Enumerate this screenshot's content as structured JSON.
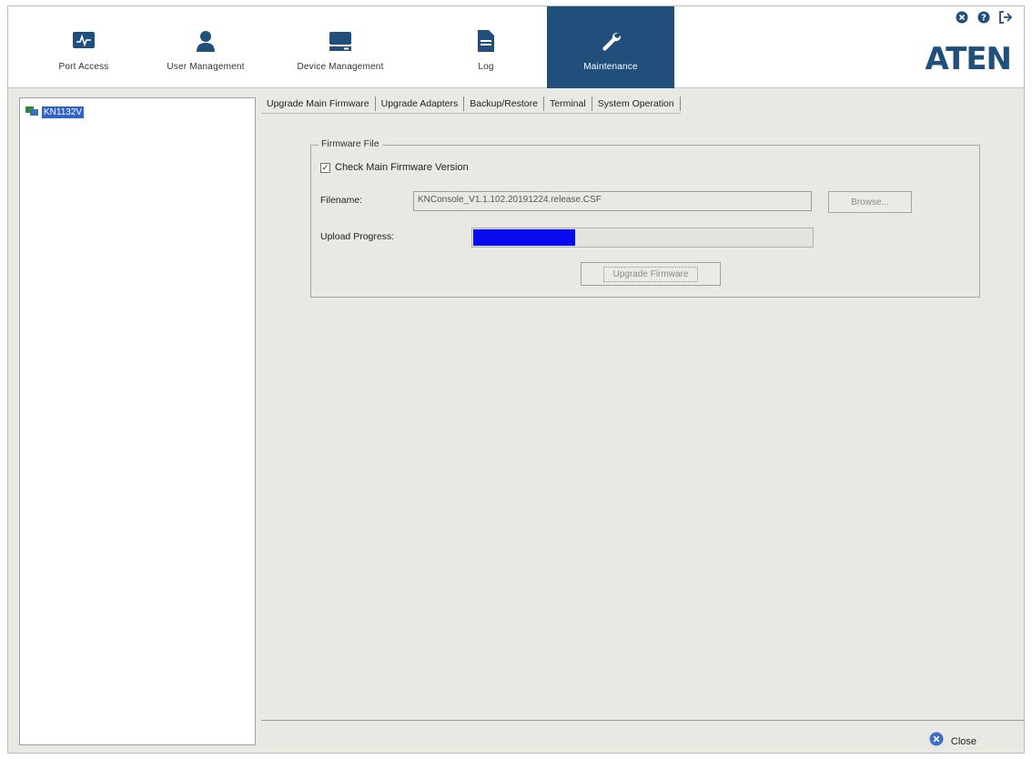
{
  "nav": {
    "items": [
      {
        "label": "Port Access",
        "icon": "monitor-icon"
      },
      {
        "label": "User Management",
        "icon": "user-icon"
      },
      {
        "label": "Device Management",
        "icon": "device-icon"
      },
      {
        "label": "Log",
        "icon": "log-icon"
      },
      {
        "label": "Maintenance",
        "icon": "wrench-icon",
        "active": true
      }
    ]
  },
  "brand": {
    "logo": "ATEN",
    "color": "#1f4f7a"
  },
  "tree": {
    "node_label": "KN1132V"
  },
  "tabs": [
    {
      "label": "Upgrade Main Firmware",
      "active": true
    },
    {
      "label": "Upgrade Adapters"
    },
    {
      "label": "Backup/Restore"
    },
    {
      "label": "Terminal"
    },
    {
      "label": "System Operation"
    }
  ],
  "firmware": {
    "group_title": "Firmware File",
    "check_label": "Check Main Firmware Version",
    "checked": true,
    "filename_label": "Filename:",
    "filename_value": "KNConsole_V1.1.102.20191224.release.CSF",
    "browse_label": "Browse...",
    "progress_label": "Upload Progress:",
    "progress_fraction": 0.3,
    "upgrade_label": "Upgrade Firmware"
  },
  "footer": {
    "close_label": "Close"
  },
  "colors": {
    "accent": "#1f4f7a",
    "progress": "#0a0aee",
    "selection": "#3163c6"
  }
}
